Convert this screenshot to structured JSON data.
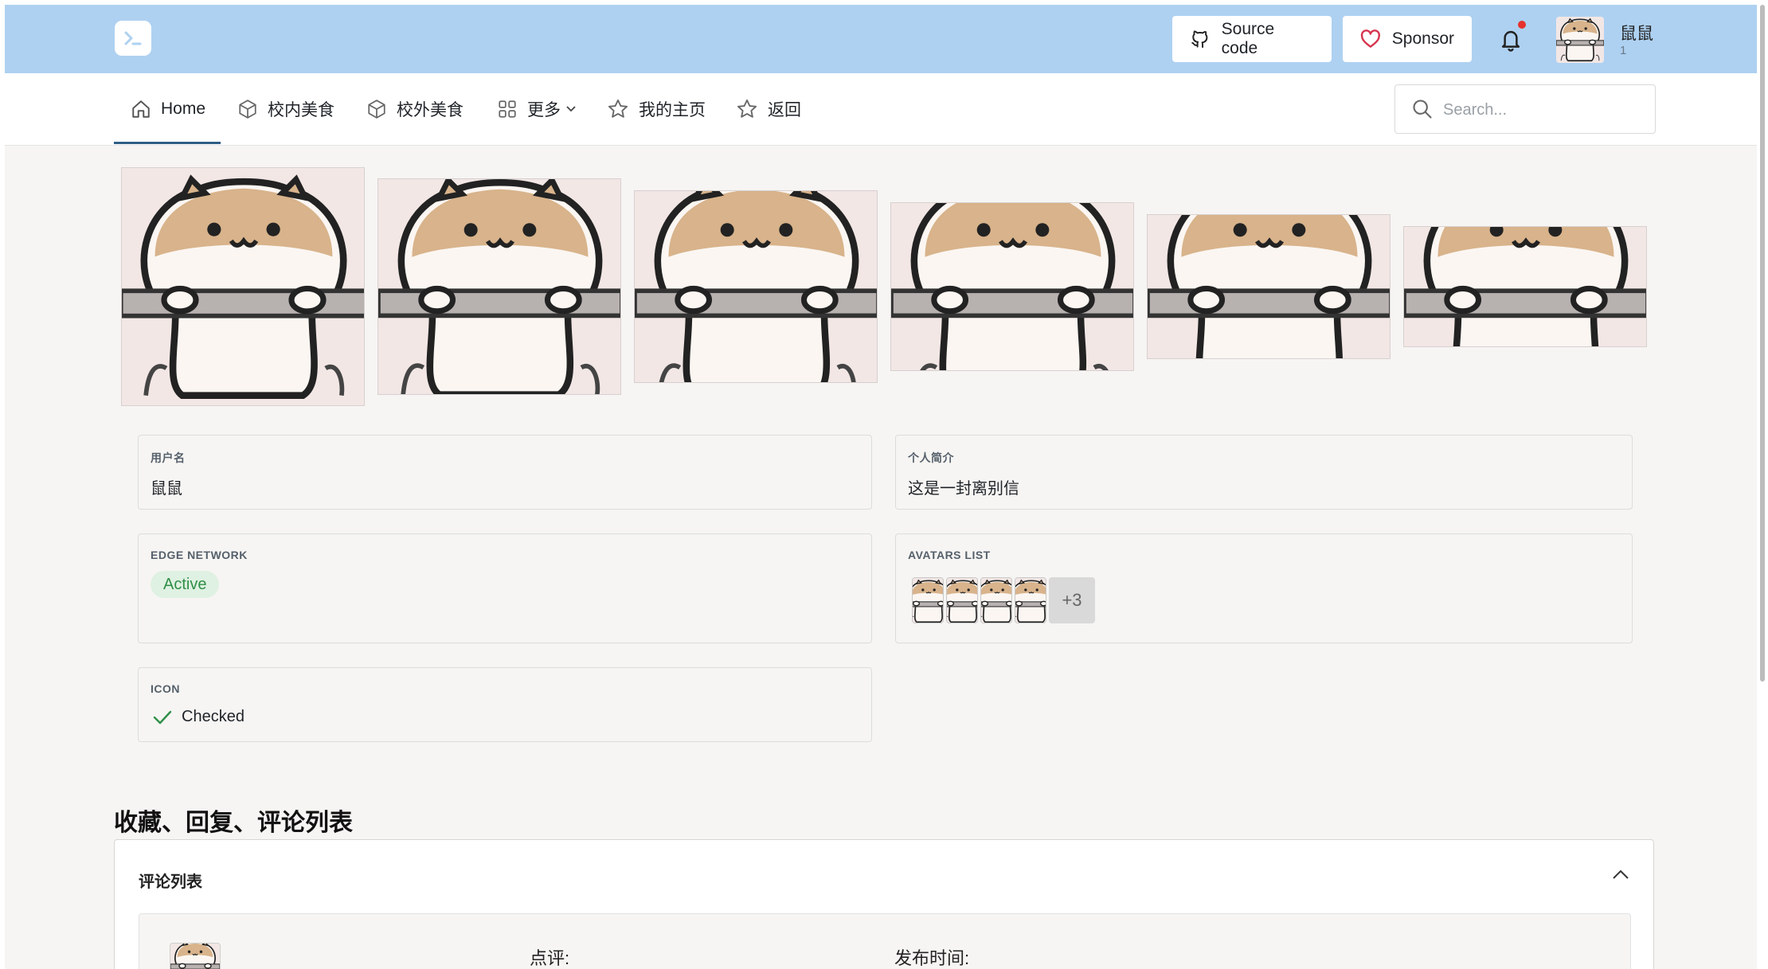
{
  "header": {
    "source_code_label": "Source code",
    "sponsor_label": "Sponsor",
    "user_name": "鼠鼠",
    "user_sub": "1",
    "accent_color": "#aed1f1",
    "notification_dot_color": "#e5322d"
  },
  "nav": {
    "items": [
      {
        "label": "Home",
        "icon": "home-icon"
      },
      {
        "label": "校内美食",
        "icon": "cube-icon"
      },
      {
        "label": "校外美食",
        "icon": "cube-icon"
      },
      {
        "label": "更多",
        "icon": "grid-icon"
      },
      {
        "label": "我的主页",
        "icon": "star-icon"
      },
      {
        "label": "返回",
        "icon": "star-icon"
      }
    ],
    "active": "Home",
    "search_placeholder": "Search..."
  },
  "gallery": {
    "image_count": 6
  },
  "profile": {
    "username_label": "用户名",
    "username_value": "鼠鼠",
    "bio_label": "个人简介",
    "bio_value": "这是一封离别信",
    "edge_label": "EDGE NETWORK",
    "edge_status": "Active",
    "avatars_label": "AVATARS LIST",
    "avatars_more": "+3",
    "icon_label": "ICON",
    "icon_status": "Checked"
  },
  "section": {
    "title": "收藏、回复、评论列表",
    "panel_title": "评论列表",
    "review_label": "点评:",
    "publish_time_label": "发布时间:"
  }
}
